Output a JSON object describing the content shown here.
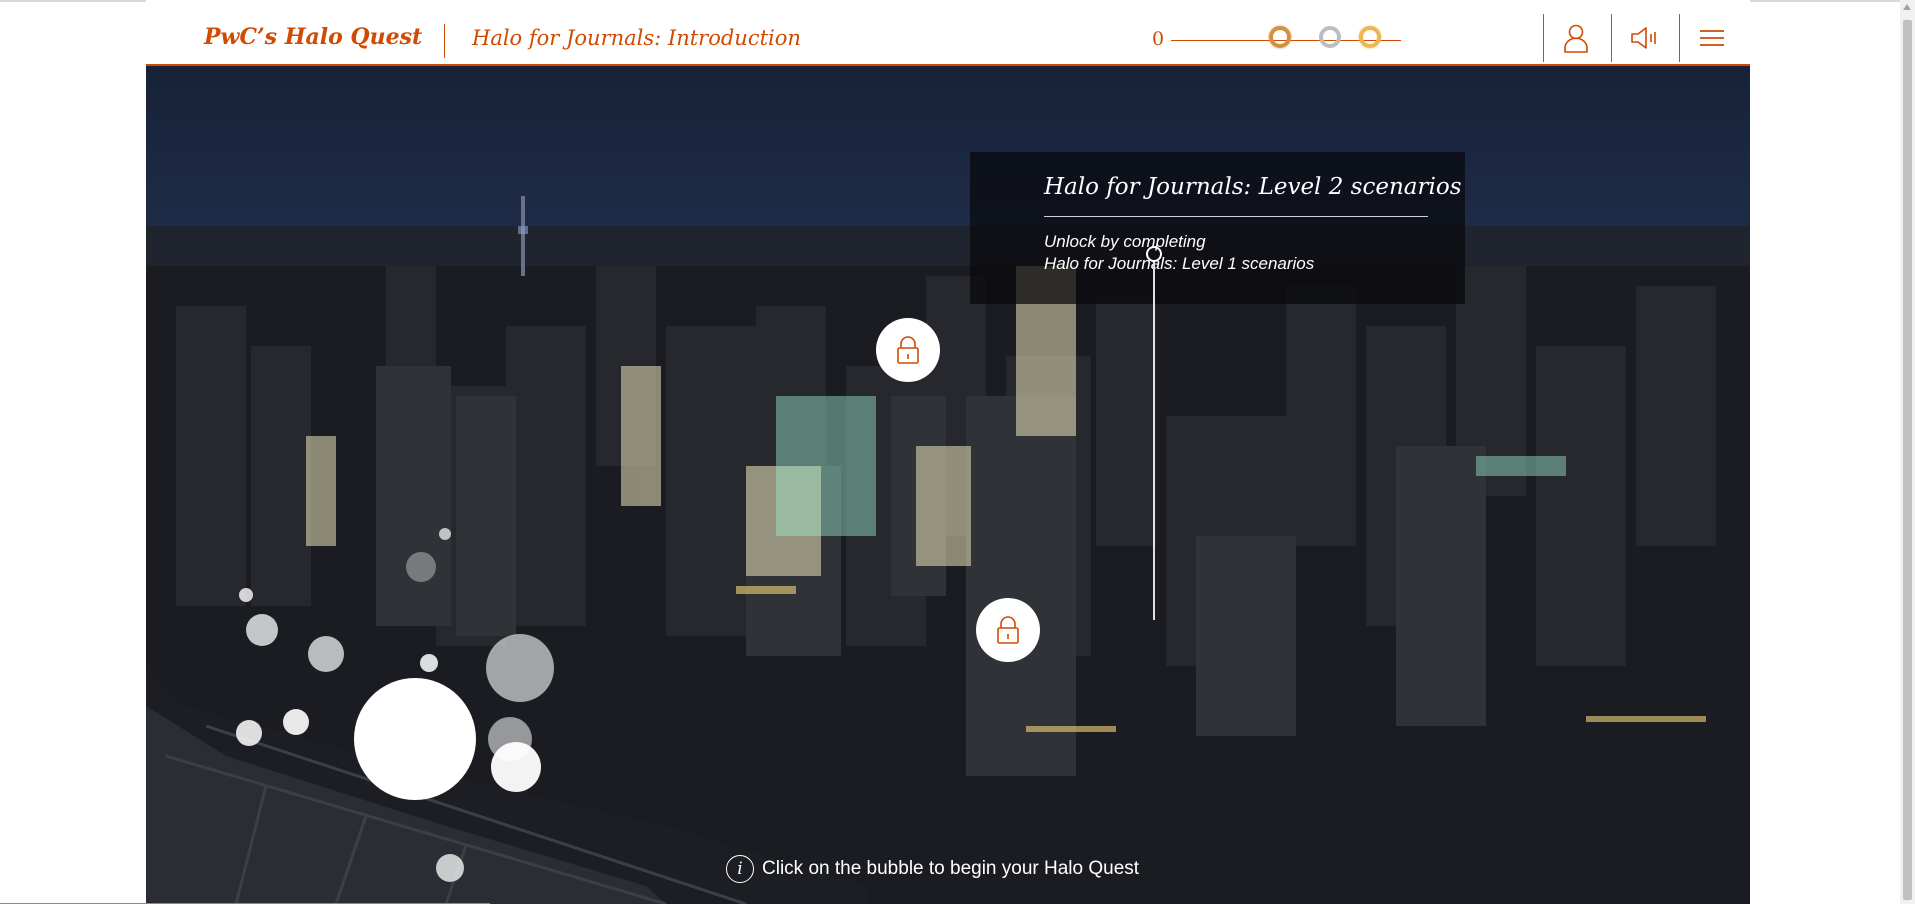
{
  "header": {
    "brand": "PwC’s Halo Quest",
    "subtitle": "Halo for Journals: Introduction",
    "score": "0",
    "progress_rings": [
      {
        "name": "bronze",
        "color": "#d4903f"
      },
      {
        "name": "silver",
        "color": "#bdbdbd"
      },
      {
        "name": "gold",
        "color": "#f0b550"
      }
    ],
    "profile_icon": "user-icon",
    "sound_icon": "speaker-icon",
    "menu_icon": "hamburger-menu-icon"
  },
  "level_card": {
    "title": "Halo for Journals: Level 2 scenarios",
    "line1": "Unlock by completing",
    "line2": "Halo for Journals: Level 1 scenarios"
  },
  "locks": {
    "icon": "padlock-icon",
    "color": "#d04a02"
  },
  "hint": {
    "icon": "info-icon",
    "glyph": "i",
    "text": "Click on the bubble to begin your Halo Quest"
  },
  "colors": {
    "accent": "#d04a02"
  }
}
